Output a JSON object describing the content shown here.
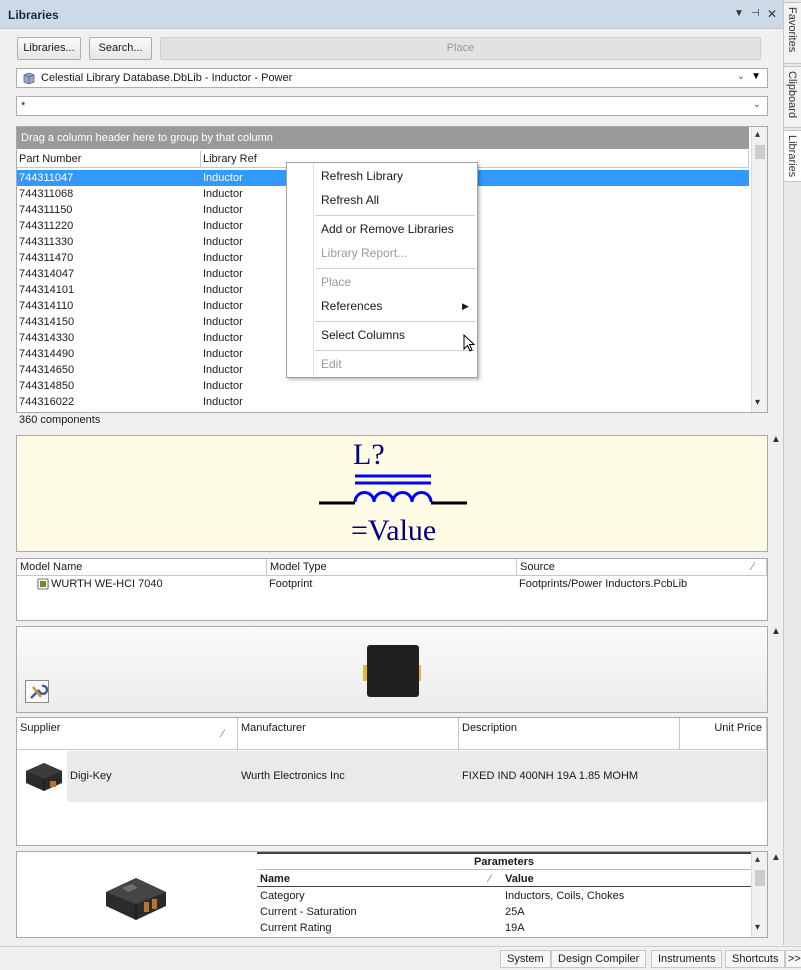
{
  "panel": {
    "title": "Libraries"
  },
  "side_tabs": [
    "Favorites",
    "Clipboard",
    "Libraries"
  ],
  "toolbar": {
    "libraries_label": "Libraries...",
    "search_label": "Search...",
    "place_label": "Place"
  },
  "library_combo": {
    "value": "Celestial Library Database.DbLib - Inductor - Power"
  },
  "filter_combo": {
    "value": "*"
  },
  "grid": {
    "group_hint": "Drag a column header here to group by that column",
    "columns": [
      "Part Number",
      "Library Ref"
    ],
    "rows": [
      {
        "part": "744311047",
        "ref": "Inductor"
      },
      {
        "part": "744311068",
        "ref": "Inductor"
      },
      {
        "part": "744311150",
        "ref": "Inductor"
      },
      {
        "part": "744311220",
        "ref": "Inductor"
      },
      {
        "part": "744311330",
        "ref": "Inductor"
      },
      {
        "part": "744311470",
        "ref": "Inductor"
      },
      {
        "part": "744314047",
        "ref": "Inductor"
      },
      {
        "part": "744314101",
        "ref": "Inductor"
      },
      {
        "part": "744314110",
        "ref": "Inductor"
      },
      {
        "part": "744314150",
        "ref": "Inductor"
      },
      {
        "part": "744314330",
        "ref": "Inductor"
      },
      {
        "part": "744314490",
        "ref": "Inductor"
      },
      {
        "part": "744314650",
        "ref": "Inductor"
      },
      {
        "part": "744314850",
        "ref": "Inductor"
      },
      {
        "part": "744316022",
        "ref": "Inductor"
      }
    ],
    "count_text": "360 components"
  },
  "context_menu": {
    "refresh_library": "Refresh Library",
    "refresh_all": "Refresh All",
    "add_remove": "Add or Remove Libraries",
    "library_report": "Library Report...",
    "place": "Place",
    "references": "References",
    "select_columns": "Select Columns",
    "edit": "Edit"
  },
  "schematic": {
    "designator": "L?",
    "value": "=Value"
  },
  "models": {
    "columns": [
      "Model Name",
      "Model Type",
      "Source"
    ],
    "row": {
      "name": "WURTH WE-HCI 7040",
      "type": "Footprint",
      "source": "Footprints/Power Inductors.PcbLib"
    }
  },
  "suppliers": {
    "columns": [
      "Supplier",
      "Manufacturer",
      "Description",
      "Unit Price"
    ],
    "row": {
      "supplier": "Digi-Key",
      "manufacturer": "Wurth Electronics Inc",
      "description": "FIXED IND 400NH 19A 1.85 MOHM"
    }
  },
  "parameters": {
    "title": "Parameters",
    "columns": [
      "Name",
      "Value"
    ],
    "rows": [
      {
        "name": "Category",
        "value": "Inductors, Coils, Chokes"
      },
      {
        "name": "Current - Saturation",
        "value": "25A"
      },
      {
        "name": "Current Rating",
        "value": "19A"
      }
    ]
  },
  "bottom_tabs": [
    "System",
    "Design Compiler",
    "Instruments",
    "Shortcuts",
    ">>"
  ]
}
